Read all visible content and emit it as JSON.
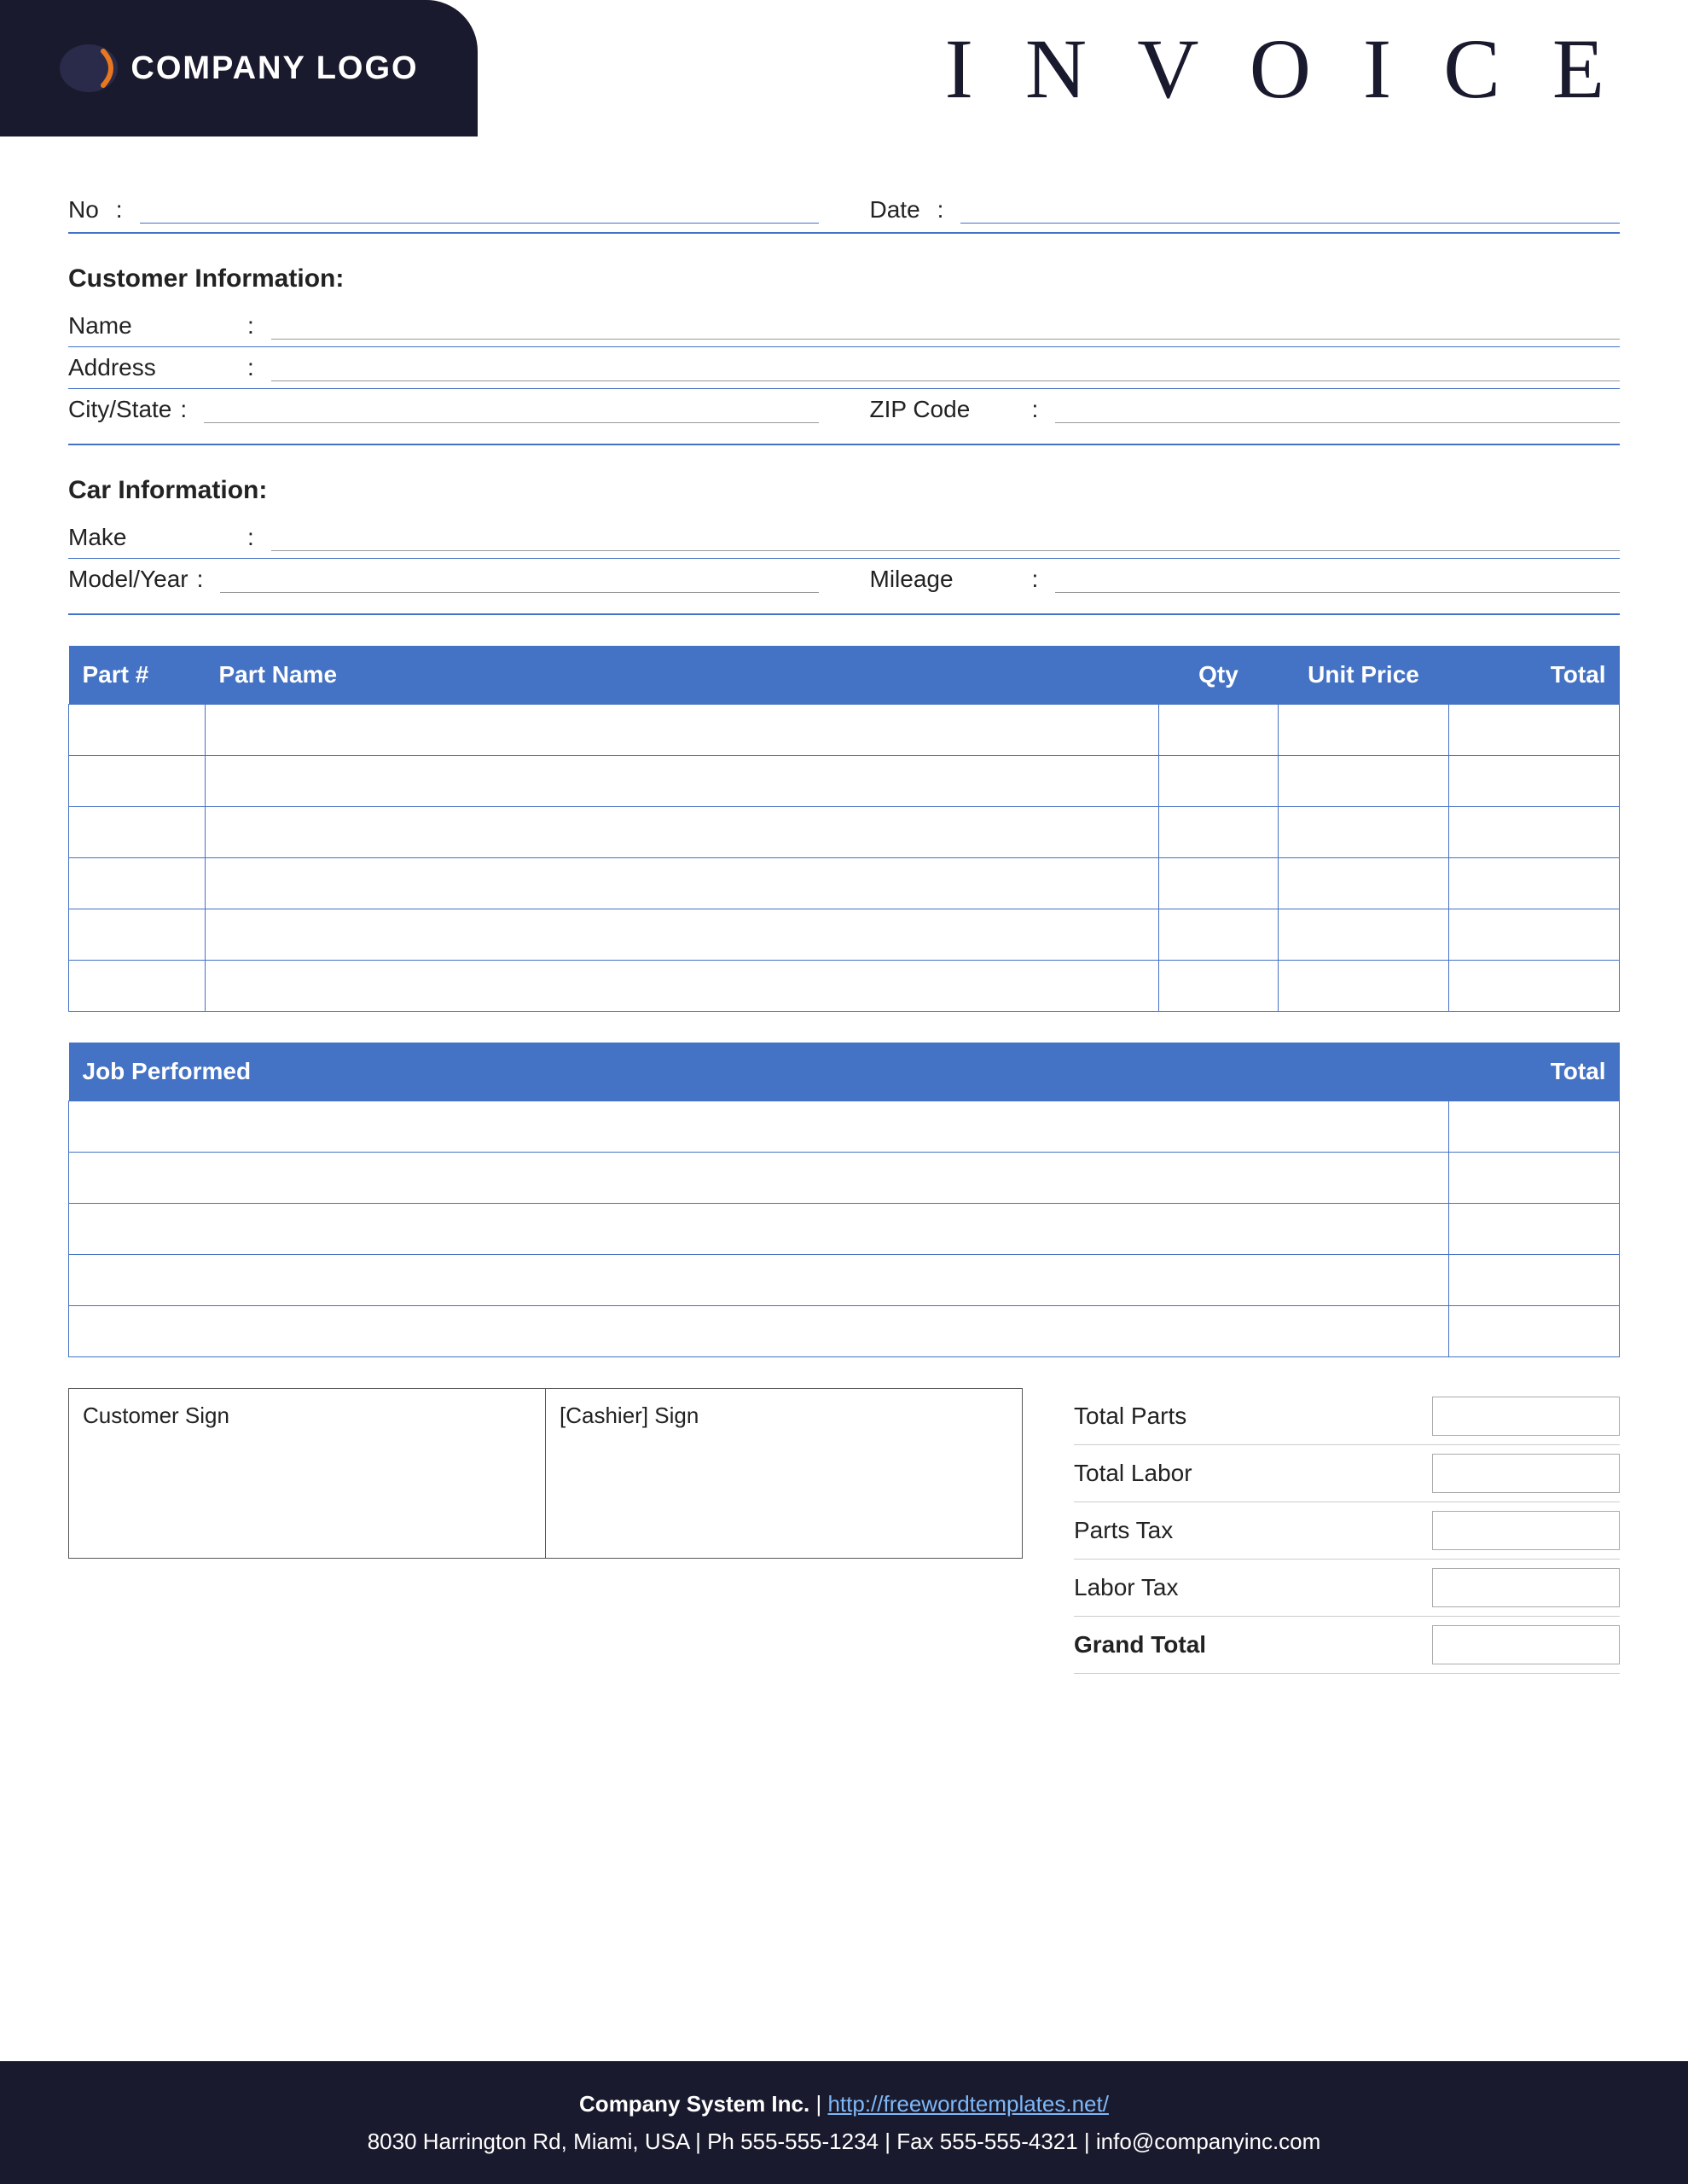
{
  "header": {
    "logo_text": "COMPANY LOGO",
    "invoice_title": "I N V O I C E"
  },
  "form": {
    "no_label": "No",
    "date_label": "Date",
    "colon": ":"
  },
  "customer_info": {
    "section_title": "Customer Information:",
    "name_label": "Name",
    "address_label": "Address",
    "city_state_label": "City/State",
    "zip_code_label": "ZIP Code"
  },
  "car_info": {
    "section_title": "Car Information:",
    "make_label": "Make",
    "model_year_label": "Model/Year",
    "mileage_label": "Mileage"
  },
  "parts_table": {
    "columns": [
      "Part #",
      "Part Name",
      "Qty",
      "Unit Price",
      "Total"
    ],
    "rows": [
      [
        "",
        "",
        "",
        "",
        ""
      ],
      [
        "",
        "",
        "",
        "",
        ""
      ],
      [
        "",
        "",
        "",
        "",
        ""
      ],
      [
        "",
        "",
        "",
        "",
        ""
      ],
      [
        "",
        "",
        "",
        "",
        ""
      ],
      [
        "",
        "",
        "",
        "",
        ""
      ]
    ]
  },
  "jobs_table": {
    "columns": [
      "Job Performed",
      "Total"
    ],
    "rows": [
      [
        "",
        ""
      ],
      [
        "",
        ""
      ],
      [
        "",
        ""
      ],
      [
        "",
        ""
      ],
      [
        "",
        ""
      ]
    ]
  },
  "signatures": {
    "customer_sign_label": "Customer Sign",
    "cashier_sign_label": "[Cashier] Sign"
  },
  "totals": {
    "total_parts_label": "Total Parts",
    "total_labor_label": "Total Labor",
    "parts_tax_label": "Parts Tax",
    "labor_tax_label": "Labor Tax",
    "grand_total_label": "Grand Total"
  },
  "footer": {
    "company_name": "Company System Inc.",
    "separator": "|",
    "website": "http://freewordtemplates.net/",
    "address": "8030 Harrington Rd, Miami, USA | Ph 555-555-1234 | Fax 555-555-4321 | info@companyinc.com"
  }
}
